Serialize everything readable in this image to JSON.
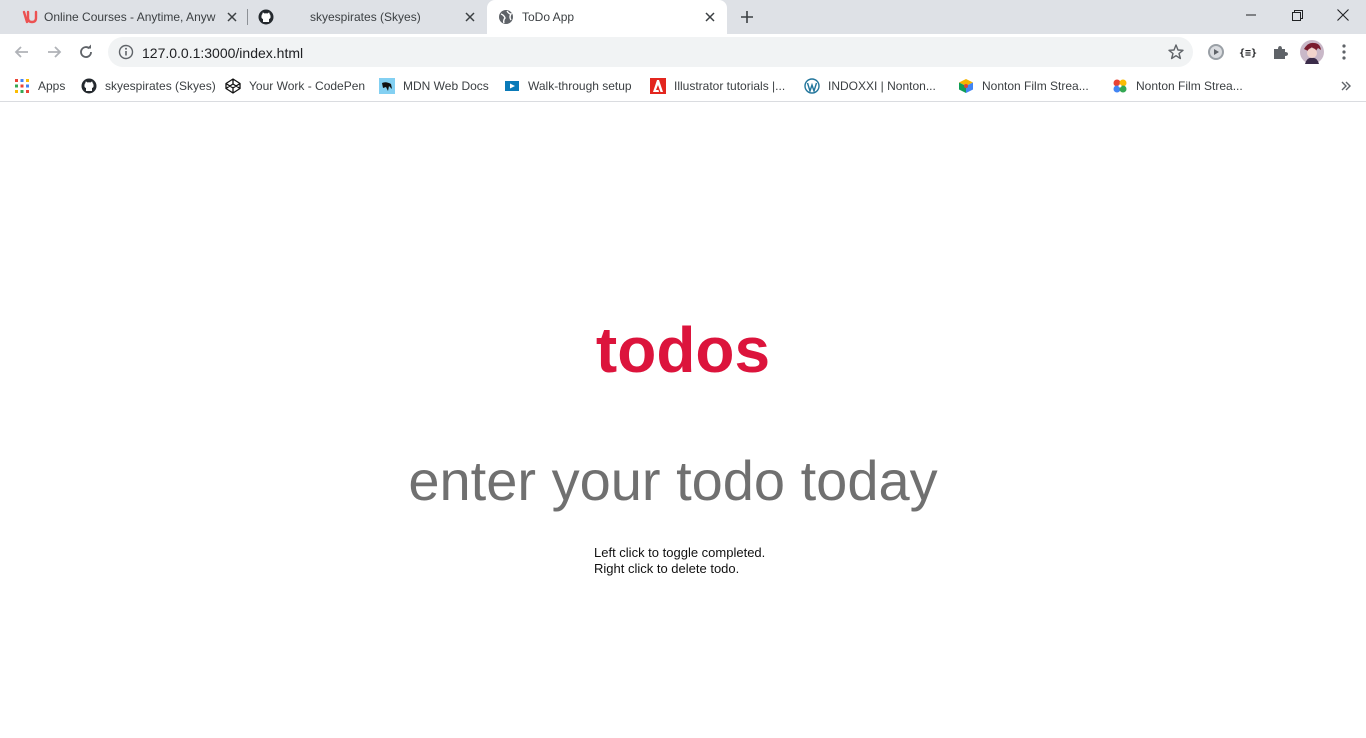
{
  "browser": {
    "tabs": [
      {
        "title": "Online Courses - Anytime, Anywh",
        "icon": "udemy-icon"
      },
      {
        "title": "skyespirates (Skyes)",
        "icon": "github-icon"
      },
      {
        "title": "ToDo App",
        "icon": "globe-icon",
        "active": true
      }
    ],
    "url": "127.0.0.1:3000/index.html"
  },
  "bookmarks": [
    {
      "label": "Apps",
      "icon": "apps-grid-icon"
    },
    {
      "label": "skyespirates (Skyes)",
      "icon": "github-icon"
    },
    {
      "label": "Your Work - CodePen",
      "icon": "codepen-icon"
    },
    {
      "label": "MDN Web Docs",
      "icon": "mdn-icon"
    },
    {
      "label": "Walk-through setup",
      "icon": "video-icon"
    },
    {
      "label": "Illustrator tutorials |...",
      "icon": "adobe-icon"
    },
    {
      "label": "INDOXXI | Nonton...",
      "icon": "wordpress-icon"
    },
    {
      "label": "Nonton Film Strea...",
      "icon": "cube-icon"
    },
    {
      "label": "Nonton Film Strea...",
      "icon": "pinwheel-icon"
    }
  ],
  "app": {
    "title": "todos",
    "input_placeholder": "enter your todo today",
    "instructions": [
      "Left click to toggle completed.",
      "Right click to delete todo."
    ]
  },
  "colors": {
    "accent": "#dc143c",
    "placeholder": "#707070",
    "tabstrip": "#dee1e6"
  }
}
